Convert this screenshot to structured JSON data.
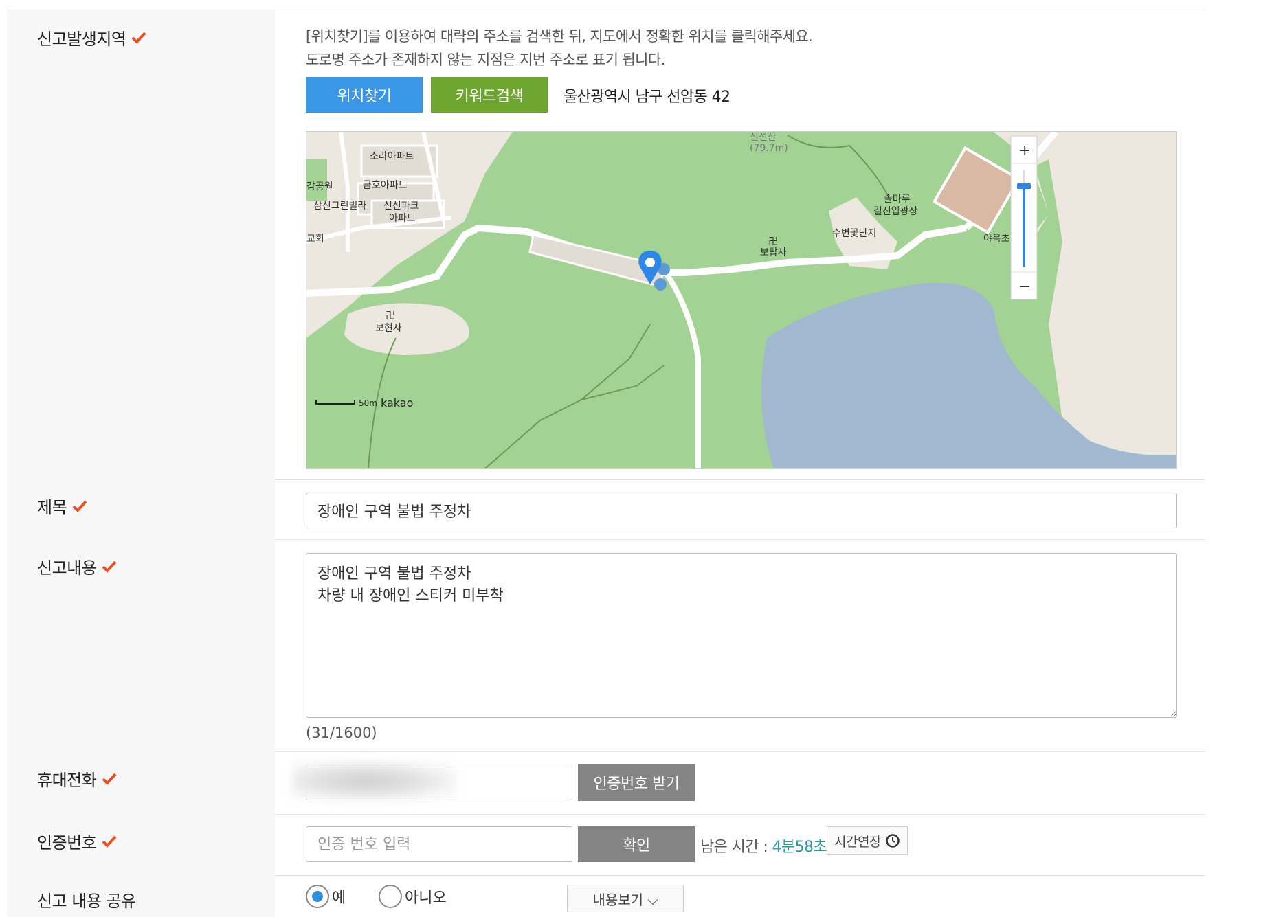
{
  "location": {
    "label": "신고발생지역",
    "desc_line1": "[위치찾기]를 이용하여 대략의 주소를 검색한 뒤, 지도에서 정확한 위치를 클릭해주세요.",
    "desc_line2": "도로명 주소가 존재하지 않는 지점은 지번 주소로 표기 됩니다.",
    "find_button": "위치찾기",
    "keyword_button": "키워드검색",
    "address": "울산광역시 남구 선암동 42",
    "map": {
      "labels": {
        "sora": "소라아파트",
        "geumho": "금호아파트",
        "samsin": "삼신그린빌라",
        "sinseon1": "신선파크",
        "sinseon2": "아파트",
        "park": "감공원",
        "church": "교회",
        "bohyeonsa": "보현사",
        "botapsa": "보탑사",
        "solmaru1": "솔마루",
        "solmaru2": "길진입광장",
        "flower": "수변꽃단지",
        "mountain1": "신선산",
        "mountain2": "(79.7m)",
        "school": "야음초"
      },
      "scale": "50m",
      "brand": "kakao",
      "zoom_in": "+",
      "zoom_out": "−",
      "zoom_level": 0.83,
      "colors": {
        "land": "#ede8df",
        "green": "#a3d394",
        "water": "#a1b8d0",
        "pin": "#2e86e6"
      }
    }
  },
  "title": {
    "label": "제목",
    "value": "장애인 구역 불법 주정차"
  },
  "content": {
    "label": "신고내용",
    "value": "장애인 구역 불법 주정차\n차량 내 장애인 스티커 미부착",
    "counter": "(31/1600)"
  },
  "phone": {
    "label": "휴대전화",
    "value": "",
    "request_button": "인증번호 받기"
  },
  "verify": {
    "label": "인증번호",
    "placeholder": "인증 번호 입력",
    "confirm_button": "확인",
    "remaining_label": "남은 시간 : ",
    "remaining_time": "4분58초",
    "extend_button": "시간연장"
  },
  "share": {
    "label": "신고 내용 공유",
    "yes": "예",
    "no": "아니오",
    "selected": "예",
    "view_button": "내용보기 ⌵"
  },
  "accent_colors": {
    "check": "#e8501f",
    "blue": "#3a96e6",
    "green": "#6ea52e",
    "time": "#2a9c98"
  }
}
